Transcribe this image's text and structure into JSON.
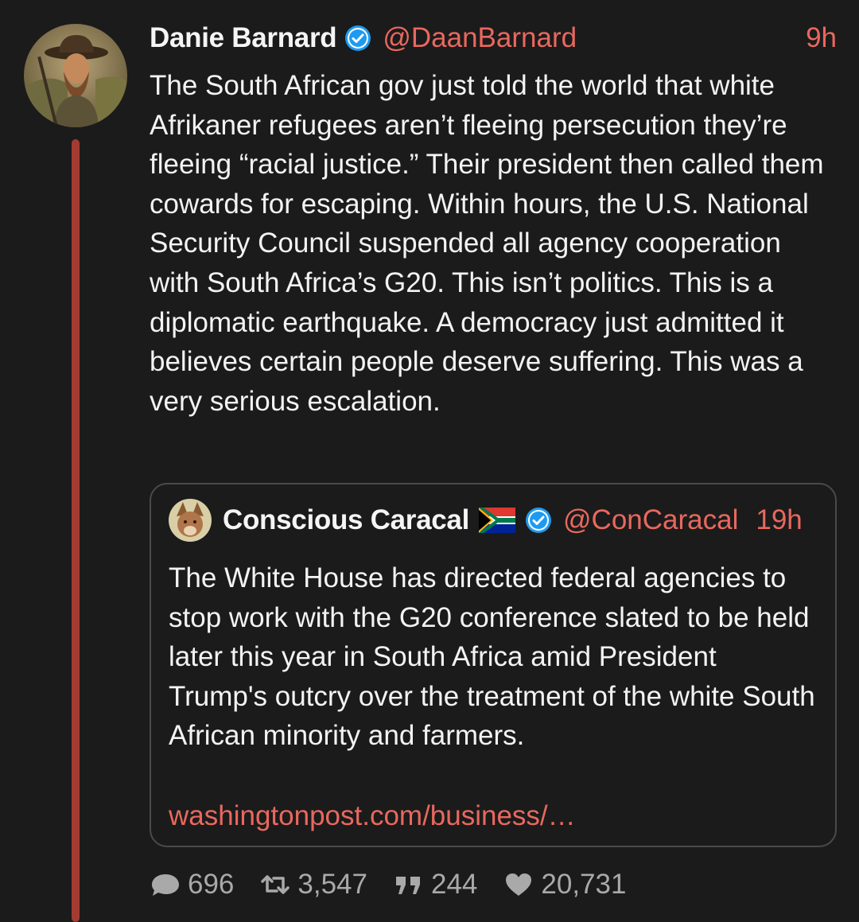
{
  "tweet": {
    "display_name": "Danie Barnard",
    "handle": "@DaanBarnard",
    "time": "9h",
    "text": "The South African gov just told the world that white Afrikaner refugees aren’t fleeing persecution they’re fleeing “racial justice.” Their president then called them cowards for escaping. Within hours, the U.S. National Security Council suspended all agency cooperation with South Africa’s G20. This isn’t politics. This is a diplomatic earthquake. A democracy just admitted it believes certain people deserve suffering. This was a very serious escalation.",
    "avatar_icon": "portrait-avatar",
    "verified_icon": "verified-badge-icon"
  },
  "quote": {
    "display_name": "Conscious Caracal",
    "flag_icon": "south-africa-flag-icon",
    "handle": "@ConCaracal",
    "time": "19h",
    "text": "The White House has directed federal agencies to stop work with the G20 conference slated to be held later this year in South Africa amid President Trump's outcry over the treatment of the white South African minority and farmers.",
    "link": "washingtonpost.com/business/…"
  },
  "actions": {
    "replies": "696",
    "retweets": "3,547",
    "quotes": "244",
    "likes": "20,731"
  },
  "colors": {
    "background": "#1b1b1b",
    "accent": "#e9685e",
    "thread_line": "#a33b33",
    "verified": "#1d9bf0",
    "muted": "#a9a9a9"
  }
}
